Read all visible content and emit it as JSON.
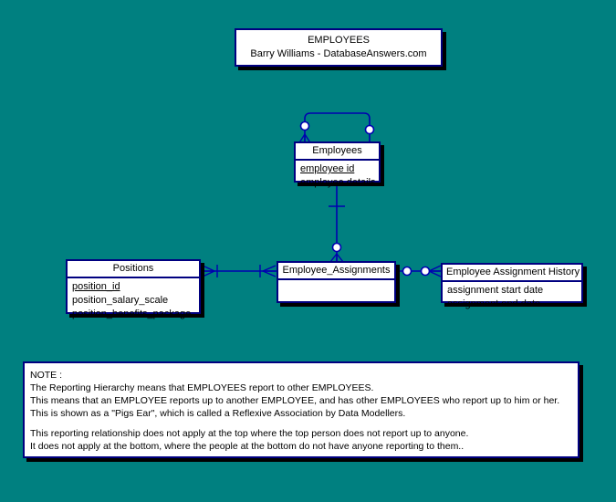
{
  "diagram": {
    "background_color": "#008080",
    "line_color": "#0000b0",
    "border_color": "#000080",
    "shadow_color": "#000000",
    "title": {
      "heading": "EMPLOYEES",
      "subheading": "Barry Williams - DatabaseAnswers.com"
    },
    "entities": [
      {
        "key": "employees",
        "name": "Employees",
        "attributes": [
          {
            "label": "employee id",
            "primary_key": true
          },
          {
            "label": "employee details",
            "primary_key": false
          }
        ]
      },
      {
        "key": "positions",
        "name": "Positions",
        "attributes": [
          {
            "label": "position_id",
            "primary_key": true
          },
          {
            "label": "position_salary_scale",
            "primary_key": false
          },
          {
            "label": "position_benefits_package",
            "primary_key": false
          }
        ]
      },
      {
        "key": "employee_assignments",
        "name": "Employee_Assignments",
        "attributes": []
      },
      {
        "key": "employee_assignment_history",
        "name": "Employee Assignment History",
        "attributes": [
          {
            "label": "assignment start date",
            "primary_key": false
          },
          {
            "label": "assignment end date",
            "primary_key": false
          }
        ]
      }
    ],
    "note": {
      "label": "NOTE :",
      "lines": [
        "The Reporting Hierarchy means that EMPLOYEES report to other EMPLOYEES.",
        "This means that an EMPLOYEE reports up to another EMPLOYEE,  and has other EMPLOYEES who report up to him or her.",
        "This is shown as a \"Pigs Ear\", which is called a Reflexive Association by Data Modellers.",
        "",
        "This reporting relationship does not apply at the top where the top person does not report  up to anyone.",
        "It does not apply at the bottom, where  the people at the bottom do not have anyone reporting to them.."
      ]
    }
  }
}
